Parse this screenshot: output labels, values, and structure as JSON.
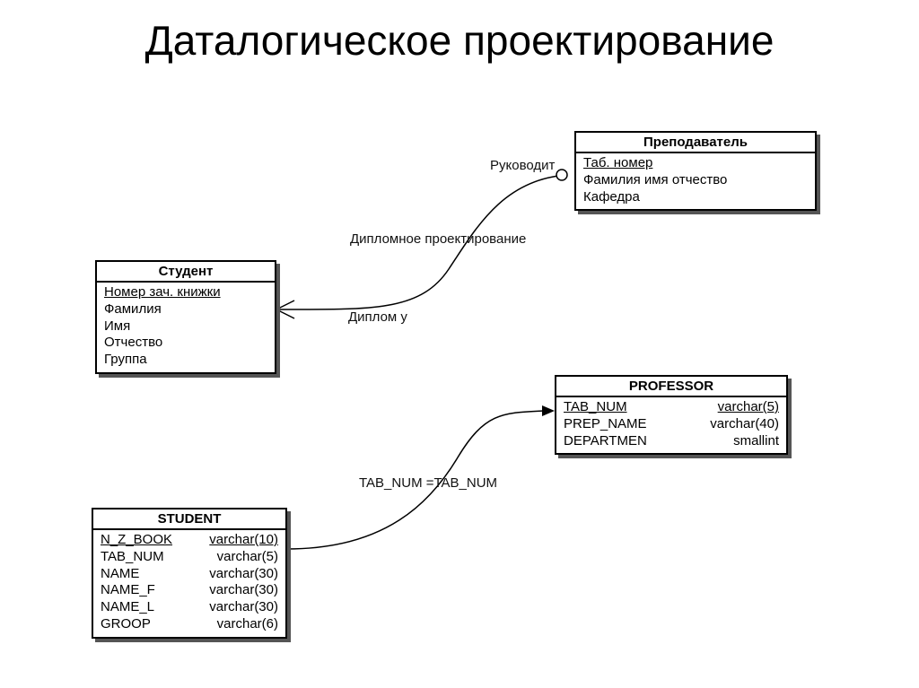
{
  "title": "Даталогическое проектирование",
  "entities": {
    "student_ru": {
      "name": "Студент",
      "attrs": [
        "Номер  зач. книжки",
        "Фамилия",
        "Имя",
        "Отчество",
        "Группа"
      ],
      "pk_index": 0
    },
    "teacher_ru": {
      "name": "Преподаватель",
      "attrs": [
        "Таб. номер",
        "Фамилия  имя  отчество",
        "Кафедра"
      ],
      "pk_index": 0
    },
    "professor_en": {
      "name": "PROFESSOR",
      "cols": [
        {
          "n": "TAB_NUM",
          "t": "varchar(5)",
          "pk": true
        },
        {
          "n": "PREP_NAME",
          "t": "varchar(40)"
        },
        {
          "n": "DEPARTMEN",
          "t": "smallint"
        }
      ]
    },
    "student_en": {
      "name": "STUDENT",
      "cols": [
        {
          "n": "N_Z_BOOK",
          "t": "varchar(10)",
          "pk": true
        },
        {
          "n": "TAB_NUM",
          "t": "varchar(5)"
        },
        {
          "n": "NAME",
          "t": "varchar(30)"
        },
        {
          "n": "NAME_F",
          "t": "varchar(30)"
        },
        {
          "n": "NAME_L",
          "t": "varchar(30)"
        },
        {
          "n": "GROOP",
          "t": "varchar(6)"
        }
      ]
    }
  },
  "relationships": {
    "supervises": "Руководит",
    "diploma_design": "Дипломное проектирование",
    "diploma_at": "Диплом у",
    "fk_join": "TAB_NUM =TAB_NUM"
  }
}
